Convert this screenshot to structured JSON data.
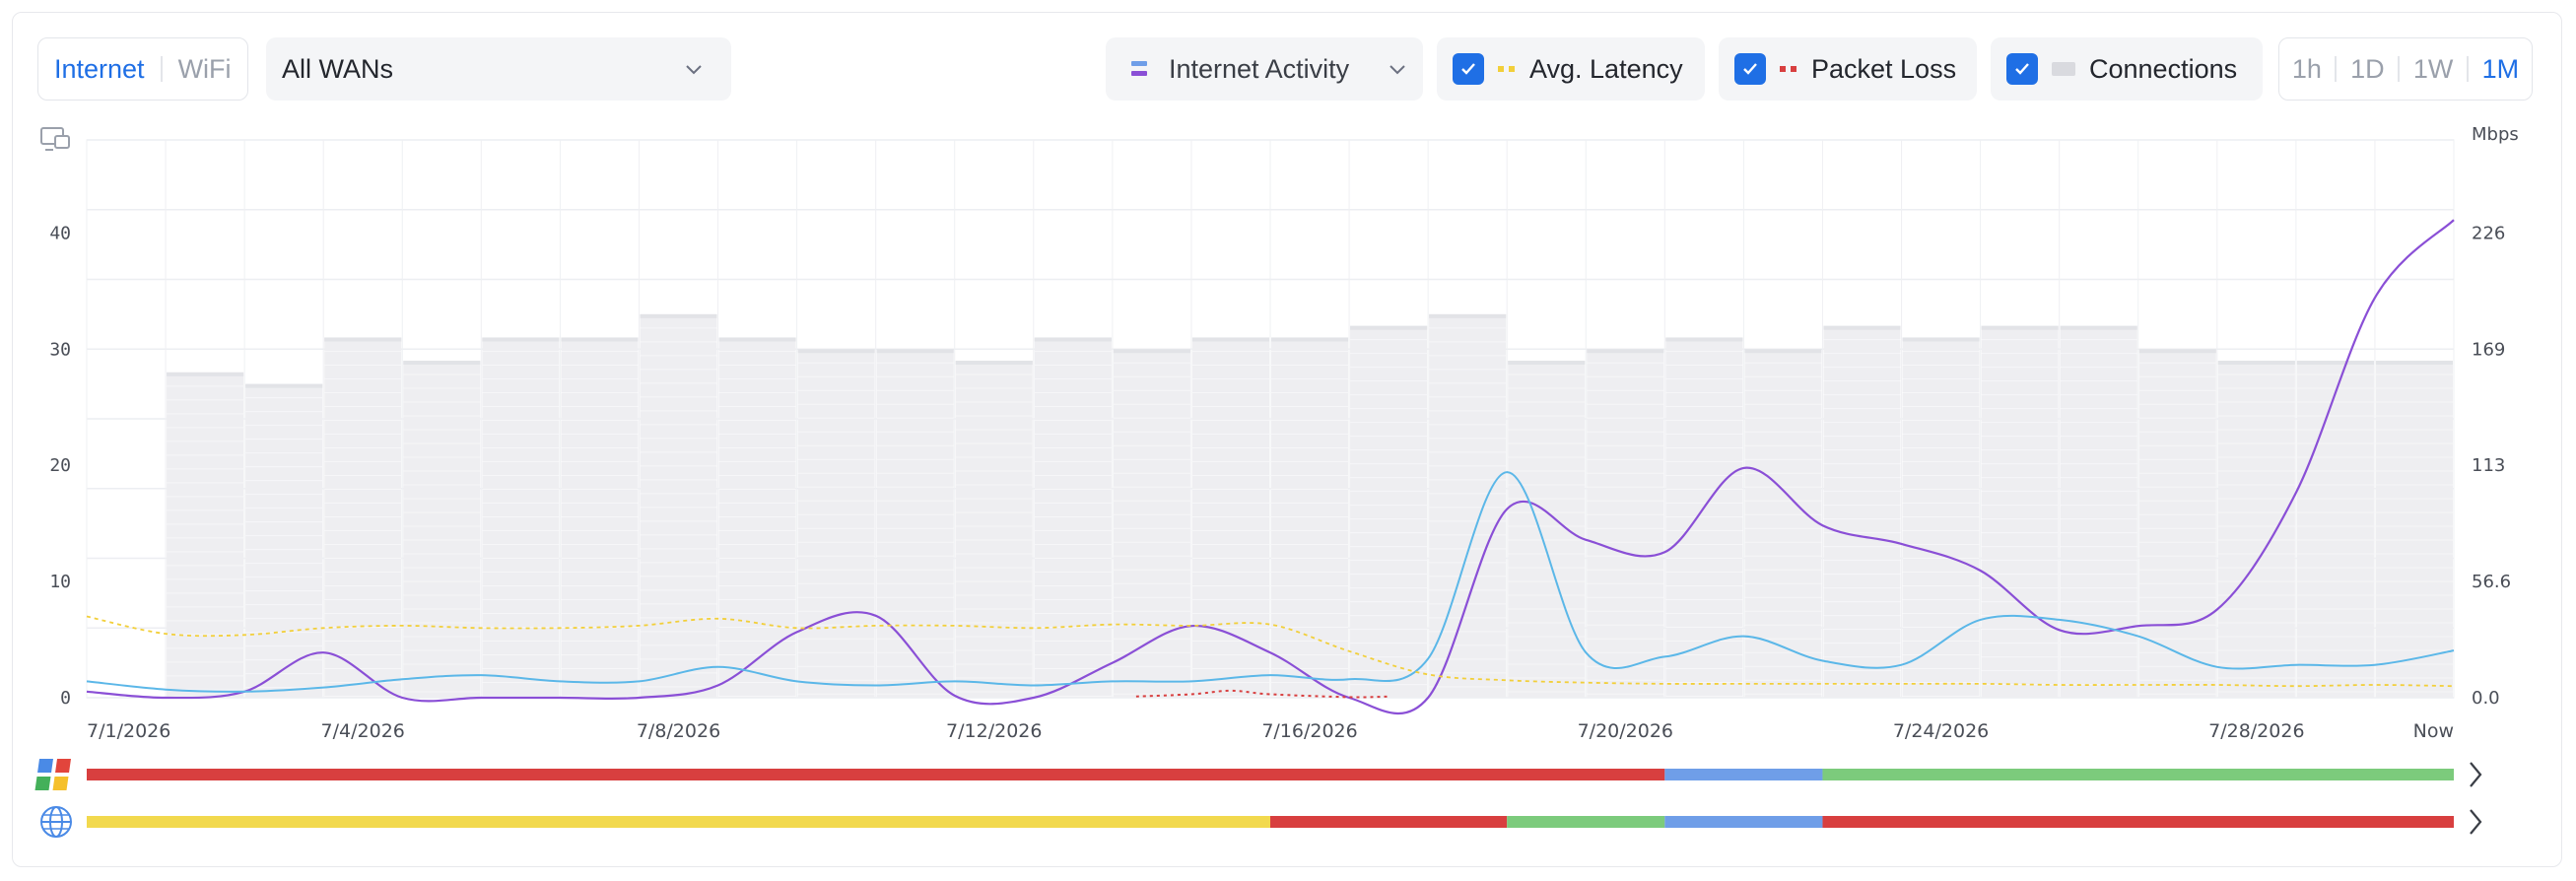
{
  "tabs": {
    "internet": "Internet",
    "wifi": "WiFi",
    "active": "Internet"
  },
  "wan_select": {
    "value": "All WANs"
  },
  "activity_select": {
    "value": "Internet Activity"
  },
  "toggles": {
    "latency": {
      "label": "Avg. Latency",
      "checked": true,
      "color": "#f2cf3a"
    },
    "packet_loss": {
      "label": "Packet Loss",
      "checked": true,
      "color": "#d83f3f"
    },
    "connections": {
      "label": "Connections",
      "checked": true,
      "color": "#d9dadf"
    }
  },
  "time_ranges": {
    "items": [
      "1h",
      "1D",
      "1W",
      "1M"
    ],
    "active": "1M"
  },
  "icons": {
    "screen": "screen-icon",
    "wan": "wan-provider-icon",
    "globe": "globe-icon",
    "chevron": "chevron-right-icon"
  },
  "colors": {
    "accent": "#1f6fe5",
    "activity": "#8a4fd6",
    "connections_line": "#5bb7e8",
    "latency": "#f2cf3a",
    "packet_loss": "#d83f3f",
    "status_red": "#d83f3f",
    "status_blue": "#6f9ee8",
    "status_green": "#7ccb7c",
    "status_yellow": "#f2d94e"
  },
  "chart_data": {
    "type": "bar",
    "x_labels": [
      "7/1/2026",
      "7/4/2026",
      "7/8/2026",
      "7/12/2026",
      "7/16/2026",
      "7/20/2026",
      "7/24/2026",
      "7/28/2026",
      "Now"
    ],
    "x_label_positions": [
      0,
      3.5,
      7.5,
      11.5,
      15.5,
      19.5,
      23.5,
      27.5,
      30
    ],
    "left_axis": {
      "ticks": [
        0,
        10,
        20,
        30,
        40
      ],
      "range": [
        0,
        48
      ]
    },
    "right_axis": {
      "unit": "Mbps",
      "ticks": [
        "0.0",
        "56.6",
        "113",
        "169",
        "226"
      ],
      "range": [
        0,
        272
      ]
    },
    "grid": true,
    "connections_bars": [
      0,
      28,
      27,
      31,
      29,
      31,
      31,
      33,
      31,
      30,
      30,
      29,
      31,
      30,
      31,
      31,
      32,
      33,
      29,
      30,
      31,
      30,
      32,
      31,
      32,
      32,
      30,
      29,
      29,
      29
    ],
    "series": [
      {
        "name": "Internet Activity",
        "key": "activity",
        "points": [
          [
            0,
            3
          ],
          [
            1,
            0
          ],
          [
            2,
            3
          ],
          [
            3,
            22
          ],
          [
            4,
            0
          ],
          [
            5,
            0
          ],
          [
            6,
            0
          ],
          [
            7,
            0
          ],
          [
            8,
            6
          ],
          [
            9,
            32
          ],
          [
            10,
            40
          ],
          [
            11,
            1
          ],
          [
            12,
            0
          ],
          [
            13,
            17
          ],
          [
            14,
            35
          ],
          [
            15,
            22
          ],
          [
            16,
            0
          ],
          [
            17,
            0
          ],
          [
            18,
            92
          ],
          [
            19,
            77
          ],
          [
            20,
            71
          ],
          [
            21,
            112
          ],
          [
            22,
            84
          ],
          [
            23,
            75
          ],
          [
            24,
            62
          ],
          [
            25,
            33
          ],
          [
            26,
            35
          ],
          [
            27,
            43
          ],
          [
            28,
            100
          ],
          [
            29,
            195
          ],
          [
            30,
            233
          ]
        ]
      },
      {
        "name": "Connections",
        "key": "connections_line",
        "points": [
          [
            0,
            8
          ],
          [
            1,
            4
          ],
          [
            2,
            3
          ],
          [
            3,
            5
          ],
          [
            4,
            9
          ],
          [
            5,
            11
          ],
          [
            6,
            8
          ],
          [
            7,
            8
          ],
          [
            8,
            15
          ],
          [
            9,
            8
          ],
          [
            10,
            6
          ],
          [
            11,
            8
          ],
          [
            12,
            6
          ],
          [
            13,
            8
          ],
          [
            14,
            8
          ],
          [
            15,
            11
          ],
          [
            16,
            9
          ],
          [
            17,
            19
          ],
          [
            18,
            110
          ],
          [
            19,
            22
          ],
          [
            20,
            20
          ],
          [
            21,
            30
          ],
          [
            22,
            18
          ],
          [
            23,
            16
          ],
          [
            24,
            38
          ],
          [
            25,
            38
          ],
          [
            26,
            30
          ],
          [
            27,
            15
          ],
          [
            28,
            16
          ],
          [
            29,
            16
          ],
          [
            30,
            23
          ]
        ]
      },
      {
        "name": "Avg. Latency",
        "key": "latency",
        "points": [
          [
            0,
            7.0
          ],
          [
            1,
            5.5
          ],
          [
            2,
            5.4
          ],
          [
            3,
            6.0
          ],
          [
            4,
            6.2
          ],
          [
            5,
            6.0
          ],
          [
            6,
            6.0
          ],
          [
            7,
            6.2
          ],
          [
            8,
            6.8
          ],
          [
            9,
            6.0
          ],
          [
            10,
            6.2
          ],
          [
            11,
            6.2
          ],
          [
            12,
            6.0
          ],
          [
            13,
            6.3
          ],
          [
            14,
            6.2
          ],
          [
            15,
            6.3
          ],
          [
            16,
            4.0
          ],
          [
            17,
            2.0
          ],
          [
            18,
            1.5
          ],
          [
            19,
            1.3
          ],
          [
            20,
            1.2
          ],
          [
            21,
            1.2
          ],
          [
            22,
            1.2
          ],
          [
            23,
            1.2
          ],
          [
            24,
            1.2
          ],
          [
            25,
            1.1
          ],
          [
            26,
            1.1
          ],
          [
            27,
            1.1
          ],
          [
            28,
            1.0
          ],
          [
            29,
            1.1
          ],
          [
            30,
            1.0
          ]
        ]
      },
      {
        "name": "Packet Loss",
        "key": "packet_loss",
        "points": [
          [
            13.3,
            0.1
          ],
          [
            14,
            0.3
          ],
          [
            14.5,
            0.6
          ],
          [
            15,
            0.3
          ],
          [
            16,
            0.05
          ],
          [
            16.5,
            0.1
          ]
        ]
      }
    ],
    "status_bars": [
      {
        "icon": "wan-provider-icon",
        "segments": [
          {
            "from": 0,
            "to": 20,
            "status": "red"
          },
          {
            "from": 20,
            "to": 22,
            "status": "blue"
          },
          {
            "from": 22,
            "to": 30,
            "status": "green"
          }
        ]
      },
      {
        "icon": "globe-icon",
        "segments": [
          {
            "from": 0,
            "to": 15,
            "status": "yellow"
          },
          {
            "from": 15,
            "to": 18,
            "status": "red"
          },
          {
            "from": 18,
            "to": 20,
            "status": "green"
          },
          {
            "from": 20,
            "to": 22,
            "status": "blue"
          },
          {
            "from": 22,
            "to": 30,
            "status": "red"
          }
        ]
      }
    ]
  }
}
